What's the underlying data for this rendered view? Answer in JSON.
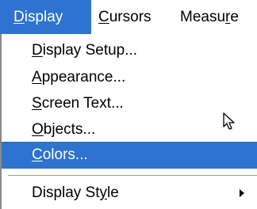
{
  "menubar": {
    "items": [
      {
        "label": "Display",
        "mnemonic_index": 0,
        "active": true
      },
      {
        "label": "Cursors",
        "mnemonic_index": 0,
        "active": false
      },
      {
        "label": "Measure",
        "mnemonic_index": 5,
        "active": false
      }
    ]
  },
  "menu": {
    "items": [
      {
        "label": "Display Setup...",
        "mnemonic_index": 0,
        "selected": false
      },
      {
        "label": "Appearance...",
        "mnemonic_index": 0,
        "selected": false
      },
      {
        "label": "Screen Text...",
        "mnemonic_index": 0,
        "selected": false
      },
      {
        "label": "Objects...",
        "mnemonic_index": 0,
        "selected": false
      },
      {
        "label": "Colors...",
        "mnemonic_index": 0,
        "selected": true
      },
      {
        "label": "Display Style",
        "mnemonic_index": 10,
        "selected": false,
        "has_submenu": true
      }
    ]
  },
  "colors": {
    "highlight": "#2d73cf",
    "highlight_text": "#ffffff",
    "text": "#000000",
    "background": "#ffffff"
  },
  "icons": {
    "pointer": "mouse-pointer-icon",
    "submenu": "submenu-arrow-icon"
  }
}
